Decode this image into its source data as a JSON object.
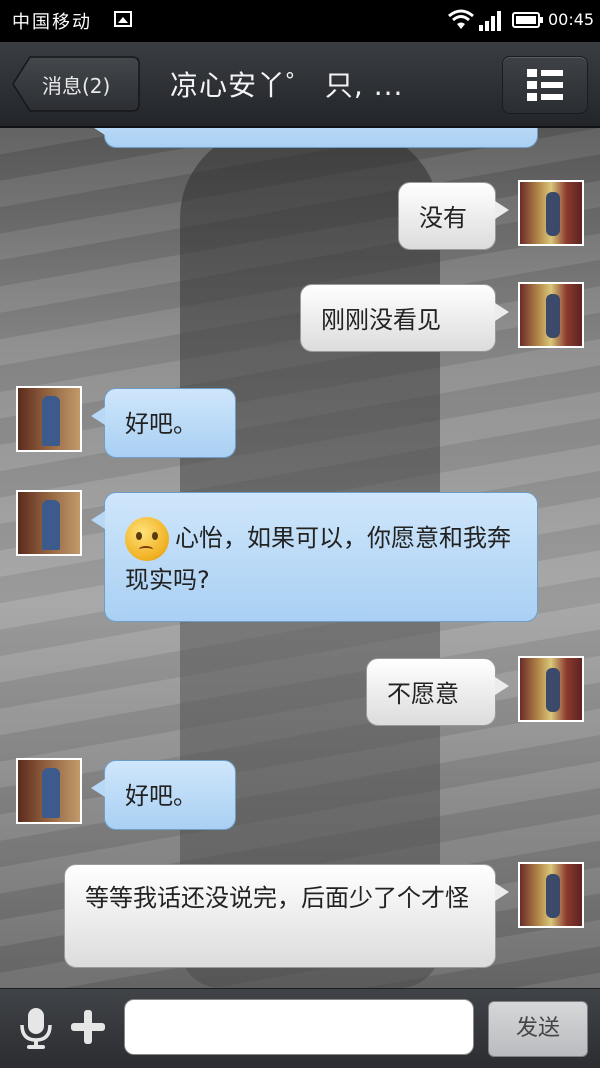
{
  "status_bar": {
    "carrier": "中国移动",
    "time": "00:45",
    "icons": [
      "image-icon",
      "wifi-icon",
      "signal-icon",
      "battery-icon"
    ]
  },
  "header": {
    "back_label": "消息(2)",
    "title": "凉心安丫゜ 只, ...",
    "menu_icon": "list-menu-icon"
  },
  "messages": [
    {
      "side": "left",
      "text": "",
      "partial": true
    },
    {
      "side": "right",
      "text": "没有"
    },
    {
      "side": "right",
      "text": "刚刚没看见"
    },
    {
      "side": "left",
      "text": "好吧。"
    },
    {
      "side": "left",
      "text": "心怡，如果可以，你愿意和我奔现实吗?",
      "emoji": "confused-face-icon"
    },
    {
      "side": "right",
      "text": "不愿意"
    },
    {
      "side": "left",
      "text": "好吧。"
    },
    {
      "side": "right",
      "text": "等等我话还没说完，后面少了个才怪"
    }
  ],
  "input_bar": {
    "placeholder": "",
    "send_label": "发送",
    "icons": [
      "microphone-icon",
      "plus-icon"
    ]
  },
  "colors": {
    "incoming_bubble": "#b7d8f6",
    "outgoing_bubble": "#ececec",
    "topbar": "#2e3136"
  }
}
